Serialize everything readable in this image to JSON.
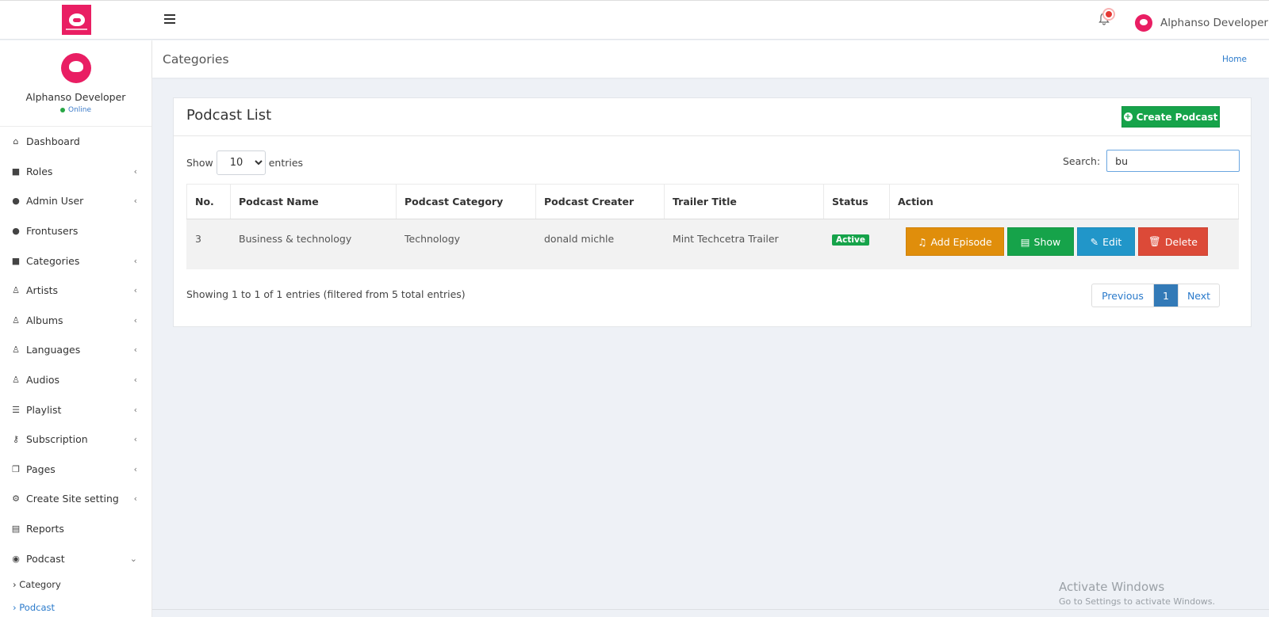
{
  "topbar": {
    "user_name": "Alphanso Developer"
  },
  "sidebar": {
    "profile": {
      "name": "Alphanso Developer",
      "status": "Online"
    },
    "items": [
      {
        "label": "Dashboard",
        "icon": "home-icon",
        "chevron": ""
      },
      {
        "label": "Roles",
        "icon": "briefcase-icon",
        "chevron": "‹"
      },
      {
        "label": "Admin User",
        "icon": "users-icon",
        "chevron": "‹"
      },
      {
        "label": "Frontusers",
        "icon": "users-icon",
        "chevron": ""
      },
      {
        "label": "Categories",
        "icon": "briefcase-icon",
        "chevron": "‹"
      },
      {
        "label": "Artists",
        "icon": "person-icon",
        "chevron": "‹"
      },
      {
        "label": "Albums",
        "icon": "person-icon",
        "chevron": "‹"
      },
      {
        "label": "Languages",
        "icon": "person-icon",
        "chevron": "‹"
      },
      {
        "label": "Audios",
        "icon": "person-icon",
        "chevron": "‹"
      },
      {
        "label": "Playlist",
        "icon": "list-icon",
        "chevron": "‹"
      },
      {
        "label": "Subscription",
        "icon": "key-icon",
        "chevron": "‹"
      },
      {
        "label": "Pages",
        "icon": "copy-icon",
        "chevron": "‹"
      },
      {
        "label": "Create Site setting",
        "icon": "gears-icon",
        "chevron": "‹"
      },
      {
        "label": "Reports",
        "icon": "file-excel-icon",
        "chevron": ""
      },
      {
        "label": "Podcast",
        "icon": "podcast-icon",
        "chevron": "⌄"
      }
    ],
    "subitems": [
      {
        "label": "Category"
      },
      {
        "label": "Podcast"
      }
    ]
  },
  "header": {
    "title": "Categories",
    "breadcrumb": "Home"
  },
  "card": {
    "title": "Podcast List",
    "create_label": "Create Podcast",
    "show_label": "Show",
    "entries_label": "entries",
    "page_length": "10",
    "search_label": "Search:",
    "search_value": "bu",
    "columns": [
      "No.",
      "Podcast Name",
      "Podcast Category",
      "Podcast Creater",
      "Trailer Title",
      "Status",
      "Action"
    ],
    "rows": [
      {
        "no": "3",
        "name": "Business & technology",
        "category": "Technology",
        "creater": "donald michle",
        "trailer": "Mint Techcetra Trailer",
        "status": "Active"
      }
    ],
    "actions": {
      "add_episode": "Add Episode",
      "show": "Show",
      "edit": "Edit",
      "delete": "Delete"
    },
    "info": "Showing 1 to 1 of 1 entries (filtered from 5 total entries)",
    "pager": {
      "previous": "Previous",
      "current": "1",
      "next": "Next"
    }
  },
  "watermark": {
    "line1": "Activate Windows",
    "line2": "Go to Settings to activate Windows."
  },
  "colors": {
    "brand": "#e91e63",
    "success": "#16a34a",
    "warning": "#e08e0b",
    "info": "#2196c9",
    "danger": "#dc4a38",
    "link": "#2a7acb"
  }
}
